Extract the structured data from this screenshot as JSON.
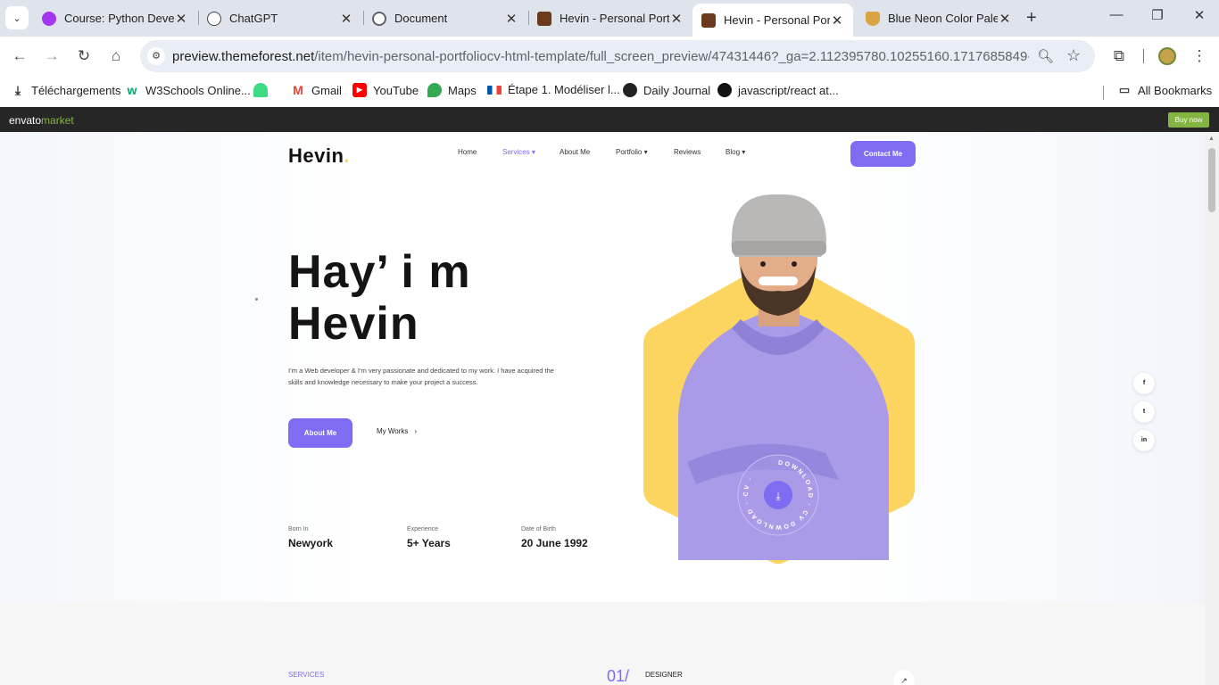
{
  "browser": {
    "tabs": [
      {
        "title": "Course: Python Devel",
        "favicon_color": "#a435f0"
      },
      {
        "title": "ChatGPT",
        "favicon_color": "#444444"
      },
      {
        "title": "Document",
        "favicon_color": "#5f6368"
      },
      {
        "title": "Hevin - Personal Port",
        "favicon_color": "#6b3a1c"
      },
      {
        "title": "Hevin - Personal Port",
        "favicon_color": "#6b3a1c"
      },
      {
        "title": "Blue Neon Color Pale",
        "favicon_color": "#d9a441"
      }
    ],
    "active_tab": 4,
    "url_host": "preview.themeforest.net",
    "url_path": "/item/hevin-personal-portfoliocv-html-template/full_screen_preview/47431446?_ga=2.112395780.10255160.1717685849-2141536...",
    "bookmarks": [
      {
        "label": "Téléchargements",
        "icon": "download-icon"
      },
      {
        "label": "W3Schools Online...",
        "icon": "w3schools-icon"
      },
      {
        "label": "",
        "icon": "android-icon"
      },
      {
        "label": "Gmail",
        "icon": "gmail-icon"
      },
      {
        "label": "YouTube",
        "icon": "youtube-icon"
      },
      {
        "label": "Maps",
        "icon": "maps-icon"
      },
      {
        "label": "Étape 1. Modéliser l...",
        "icon": "flag-icon"
      },
      {
        "label": "Daily Journal",
        "icon": "globe-icon"
      },
      {
        "label": "javascript/react at...",
        "icon": "github-icon"
      }
    ],
    "all_bookmarks": "All Bookmarks"
  },
  "envato": {
    "logo_envato": "envato",
    "logo_market": "market",
    "buy_now": "Buy now"
  },
  "site": {
    "brand": "Hevin",
    "brand_dot": ".",
    "menu": [
      "Home",
      "Services",
      "About Me",
      "Portfolio",
      "Reviews",
      "Blog"
    ],
    "active_menu": "Services",
    "contact_button": "Contact Me",
    "hero_line1": "Hay’ i m",
    "hero_line2": "Hevin",
    "hero_text": "I’m a Web developer & I’m very passionate and dedicated to my work. I have acquired the skills and knowledge necessary to make your project a success.",
    "about_button": "About Me",
    "works_link": "My Works",
    "stats": [
      {
        "label": "Born In",
        "value": "Newyork"
      },
      {
        "label": "Experience",
        "value": "5+ Years"
      },
      {
        "label": "Date of Birth",
        "value": "20 June 1992"
      }
    ],
    "cv_badge_text": "DOWNLOAD · CV DOWNLOAD · CV ·",
    "social": [
      "f",
      "t",
      "in"
    ],
    "services_label": "SERVICES",
    "service_number": "01/",
    "service_title": "DESIGNER",
    "colors": {
      "accent": "#7e6cf2",
      "hexagon": "#fcd460",
      "hoodie": "#a99be8"
    }
  }
}
